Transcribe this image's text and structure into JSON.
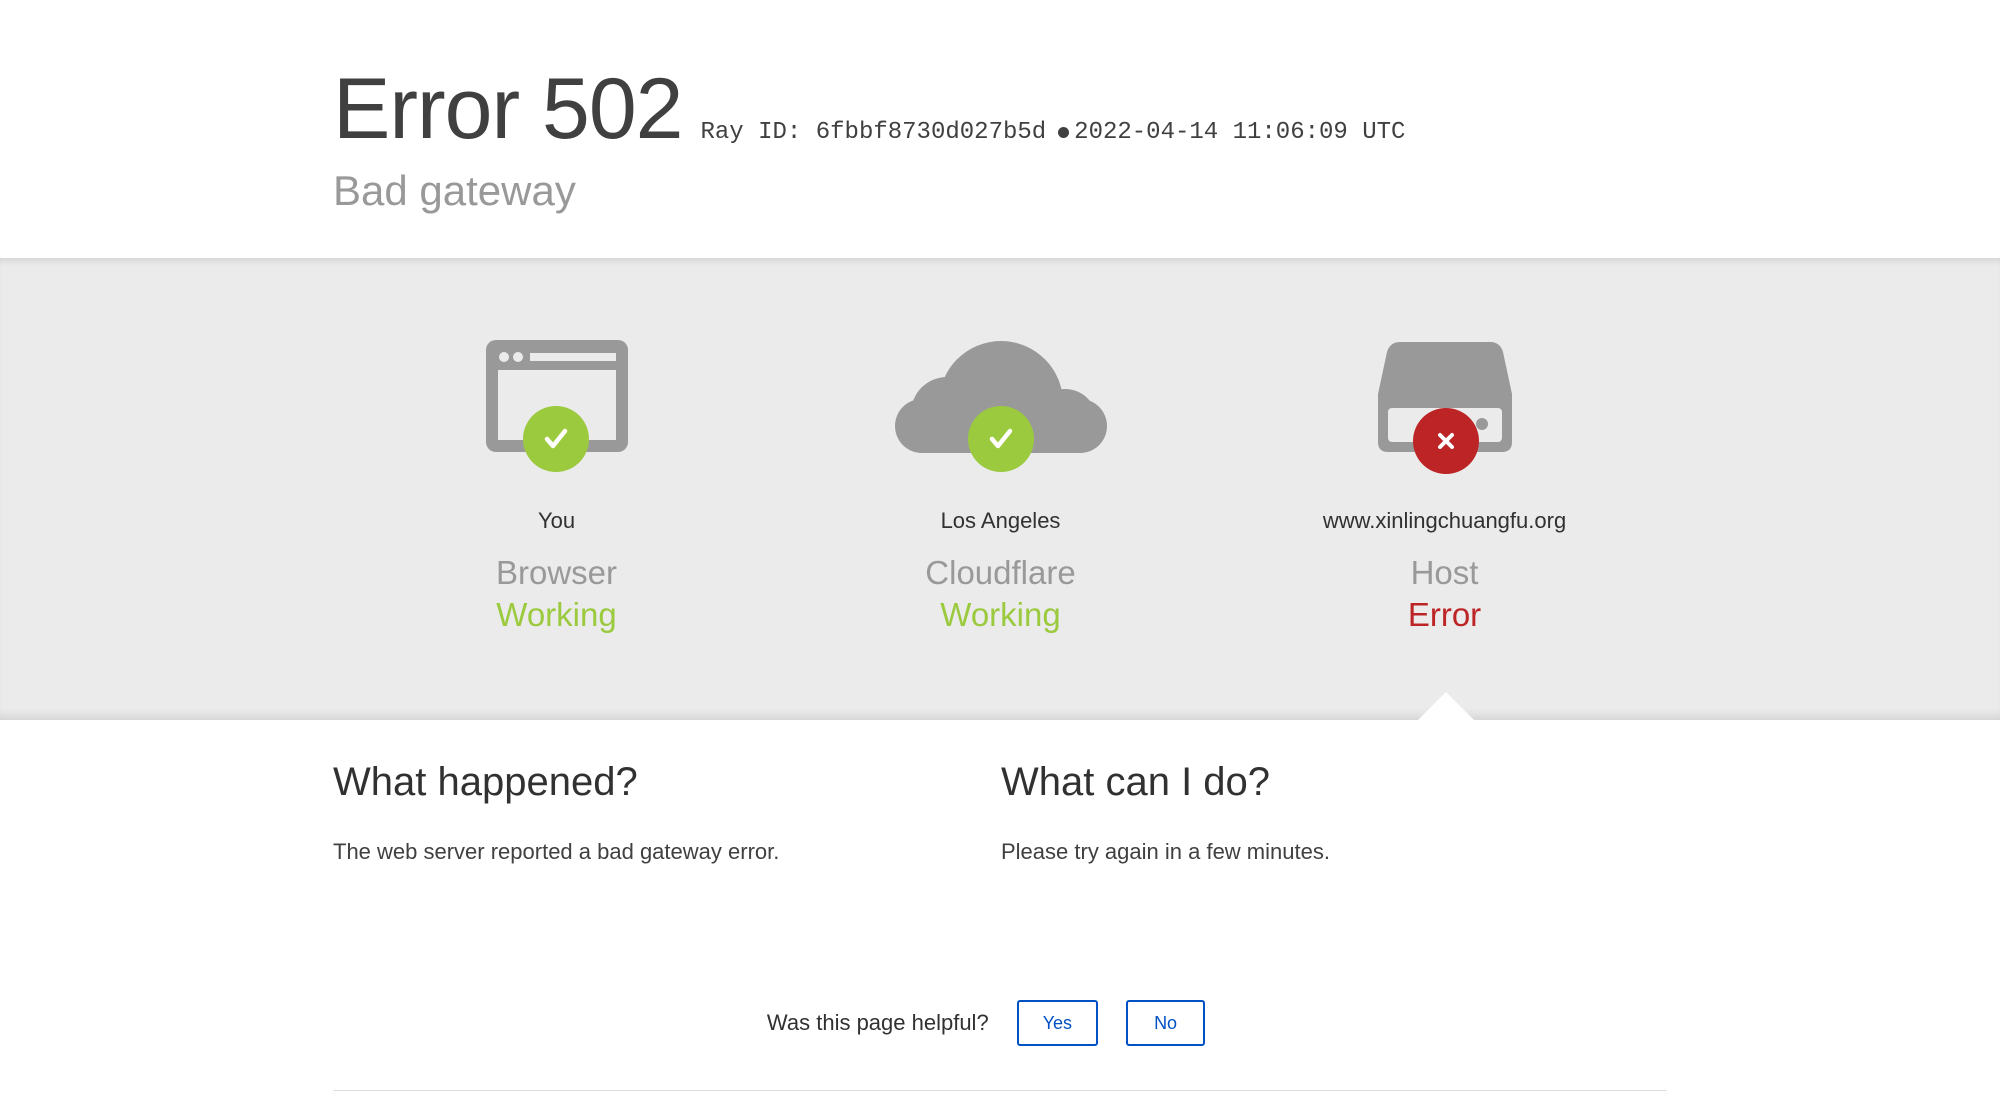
{
  "header": {
    "error_title": "Error 502",
    "ray_label": "Ray ID:",
    "ray_id": "6fbbf8730d027b5d",
    "timestamp": "2022-04-14 11:06:09 UTC",
    "subtitle": "Bad gateway"
  },
  "status": [
    {
      "location": "You",
      "name": "Browser",
      "state": "Working",
      "state_kind": "ok",
      "icon": "browser-icon",
      "badge_icon": "checkmark-icon"
    },
    {
      "location": "Los Angeles",
      "name": "Cloudflare",
      "state": "Working",
      "state_kind": "ok",
      "icon": "cloud-icon",
      "badge_icon": "checkmark-icon"
    },
    {
      "location": "www.xinlingchuangfu.org",
      "name": "Host",
      "state": "Error",
      "state_kind": "err",
      "icon": "server-icon",
      "badge_icon": "x-icon"
    }
  ],
  "colors": {
    "ok": "#9bca3e",
    "error": "#bd2426",
    "icon_gray": "#999999",
    "band_bg": "#ebebeb",
    "button_border": "#0051c3"
  },
  "what_happened": {
    "heading": "What happened?",
    "body": "The web server reported a bad gateway error."
  },
  "what_can_i_do": {
    "heading": "What can I do?",
    "body": "Please try again in a few minutes."
  },
  "feedback": {
    "question": "Was this page helpful?",
    "yes_label": "Yes",
    "no_label": "No"
  }
}
